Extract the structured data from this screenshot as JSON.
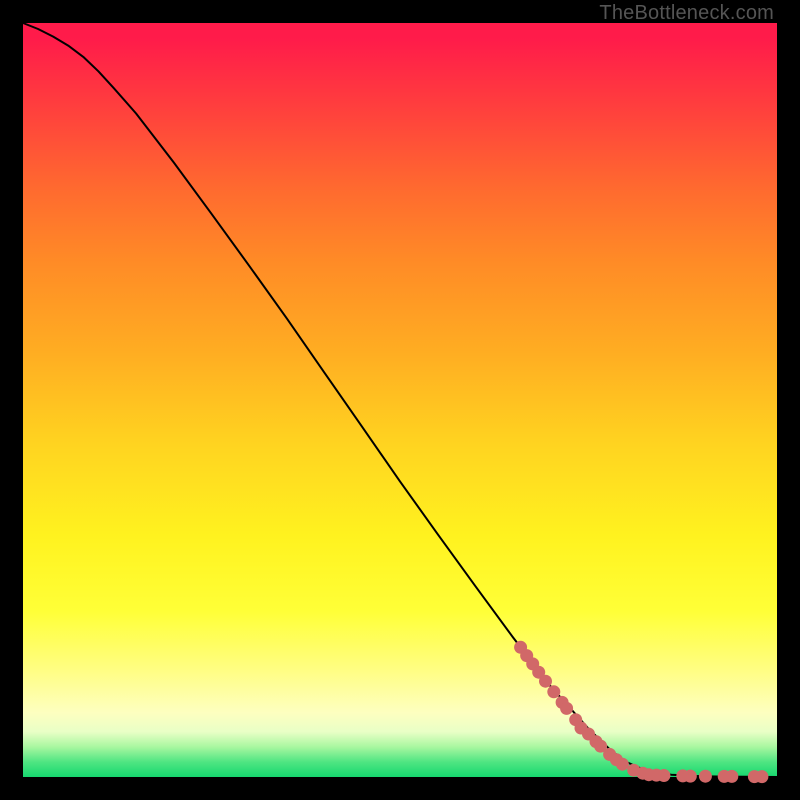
{
  "watermark": "TheBottleneck.com",
  "colors": {
    "page_bg": "#000000",
    "curve": "#000000",
    "dot": "#d16868",
    "gradient_top": "#ff1b4a",
    "gradient_green": "#16d86f"
  },
  "chart_data": {
    "type": "line",
    "title": "",
    "xlabel": "",
    "ylabel": "",
    "xlim": [
      0,
      100
    ],
    "ylim": [
      0,
      100
    ],
    "curve": [
      {
        "x": 0,
        "y": 100
      },
      {
        "x": 2,
        "y": 99.2
      },
      {
        "x": 4,
        "y": 98.2
      },
      {
        "x": 6,
        "y": 97.0
      },
      {
        "x": 8,
        "y": 95.5
      },
      {
        "x": 10,
        "y": 93.6
      },
      {
        "x": 12,
        "y": 91.4
      },
      {
        "x": 15,
        "y": 88.0
      },
      {
        "x": 20,
        "y": 81.5
      },
      {
        "x": 25,
        "y": 74.7
      },
      {
        "x": 30,
        "y": 67.8
      },
      {
        "x": 35,
        "y": 60.8
      },
      {
        "x": 40,
        "y": 53.6
      },
      {
        "x": 45,
        "y": 46.4
      },
      {
        "x": 50,
        "y": 39.2
      },
      {
        "x": 55,
        "y": 32.2
      },
      {
        "x": 60,
        "y": 25.3
      },
      {
        "x": 65,
        "y": 18.5
      },
      {
        "x": 70,
        "y": 12.0
      },
      {
        "x": 75,
        "y": 6.4
      },
      {
        "x": 78,
        "y": 3.5
      },
      {
        "x": 80,
        "y": 2.0
      },
      {
        "x": 82,
        "y": 1.1
      },
      {
        "x": 84,
        "y": 0.6
      },
      {
        "x": 86,
        "y": 0.3
      },
      {
        "x": 88,
        "y": 0.2
      },
      {
        "x": 90,
        "y": 0.1
      },
      {
        "x": 93,
        "y": 0.05
      },
      {
        "x": 96,
        "y": 0.02
      },
      {
        "x": 100,
        "y": 0.0
      }
    ],
    "series": [
      {
        "name": "markers",
        "points": [
          {
            "x": 66.0,
            "y": 17.2
          },
          {
            "x": 66.8,
            "y": 16.1
          },
          {
            "x": 67.6,
            "y": 15.0
          },
          {
            "x": 68.4,
            "y": 13.9
          },
          {
            "x": 69.3,
            "y": 12.7
          },
          {
            "x": 70.4,
            "y": 11.3
          },
          {
            "x": 71.5,
            "y": 9.9
          },
          {
            "x": 72.1,
            "y": 9.1
          },
          {
            "x": 73.3,
            "y": 7.6
          },
          {
            "x": 74.0,
            "y": 6.5
          },
          {
            "x": 75.0,
            "y": 5.7
          },
          {
            "x": 76.0,
            "y": 4.7
          },
          {
            "x": 76.6,
            "y": 4.1
          },
          {
            "x": 77.8,
            "y": 3.0
          },
          {
            "x": 78.7,
            "y": 2.3
          },
          {
            "x": 79.5,
            "y": 1.7
          },
          {
            "x": 81.0,
            "y": 0.9
          },
          {
            "x": 82.2,
            "y": 0.5
          },
          {
            "x": 83.0,
            "y": 0.3
          },
          {
            "x": 84.0,
            "y": 0.25
          },
          {
            "x": 85.0,
            "y": 0.2
          },
          {
            "x": 87.5,
            "y": 0.15
          },
          {
            "x": 88.5,
            "y": 0.12
          },
          {
            "x": 90.5,
            "y": 0.1
          },
          {
            "x": 93.0,
            "y": 0.08
          },
          {
            "x": 94.0,
            "y": 0.08
          },
          {
            "x": 97.0,
            "y": 0.05
          },
          {
            "x": 98.0,
            "y": 0.05
          }
        ]
      }
    ]
  }
}
